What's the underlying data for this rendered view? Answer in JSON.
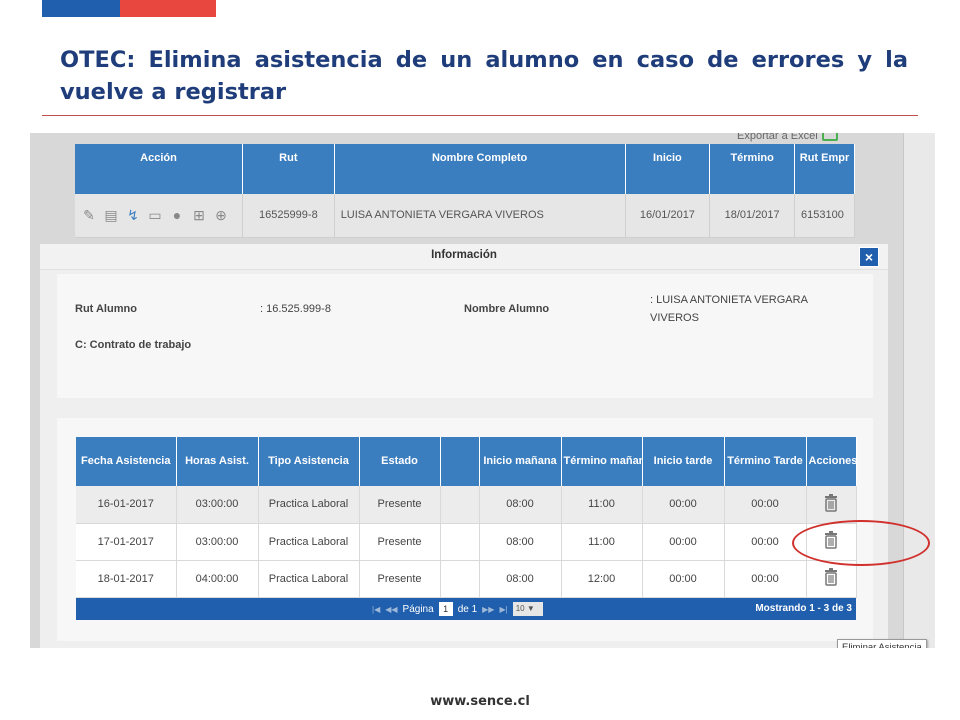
{
  "slide": {
    "title": "OTEC: Elimina asistencia de un alumno en caso de errores y la vuelve a registrar",
    "footer_url": "www.sence.cl",
    "colors": {
      "brand_blue": "#1f5fad",
      "brand_red": "#e8473f",
      "table_header": "#3b7ec0",
      "highlight": "#d0312d"
    }
  },
  "export": {
    "label": "Exportar a Excel",
    "icon": "excel-icon"
  },
  "background_table": {
    "headers": [
      "Acción",
      "Rut",
      "Nombre Completo",
      "Inicio",
      "Término",
      "Rut Empr"
    ],
    "row": {
      "rut": "16525999-8",
      "nombre": "LUISA ANTONIETA VERGARA VIVEROS",
      "inicio": "16/01/2017",
      "termino": "18/01/2017",
      "rut_empresa": "6153100"
    },
    "action_icons": [
      "user-edit-icon",
      "document-icon",
      "paperclip-icon",
      "file-icon",
      "user-remove-icon",
      "add-file-icon",
      "add-circle-icon"
    ]
  },
  "modal": {
    "title": "Información",
    "close_label": "×",
    "info": {
      "rut_label": "Rut Alumno",
      "rut_value": ": 16.525.999-8",
      "nombre_label": "Nombre Alumno",
      "nombre_value": ": LUISA ANTONIETA VERGARA VIVEROS",
      "contrato_label": "C: Contrato de trabajo"
    },
    "table": {
      "headers": [
        "Fecha Asistencia",
        "Horas Asist.",
        "Tipo Asistencia",
        "Estado",
        "",
        "Inicio mañana",
        "Término mañana",
        "Inicio tarde",
        "Término Tarde",
        "Acciones"
      ],
      "rows": [
        [
          "16-01-2017",
          "03:00:00",
          "Practica Laboral",
          "Presente",
          "",
          "08:00",
          "11:00",
          "00:00",
          "00:00"
        ],
        [
          "17-01-2017",
          "03:00:00",
          "Practica Laboral",
          "Presente",
          "",
          "08:00",
          "11:00",
          "00:00",
          "00:00"
        ],
        [
          "18-01-2017",
          "04:00:00",
          "Practica Laboral",
          "Presente",
          "",
          "08:00",
          "12:00",
          "00:00",
          "00:00"
        ]
      ]
    },
    "pager": {
      "page_label": "Página",
      "page_value": "1",
      "of_label": "de 1",
      "rows_per_page": "10",
      "summary": "Mostrando 1 - 3 de 3"
    },
    "tooltip": "Eliminar Asistencia"
  }
}
